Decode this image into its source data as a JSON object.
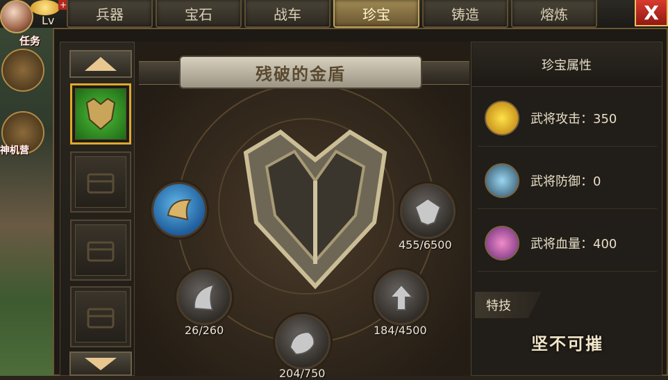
{
  "tabs": [
    {
      "label": "兵器"
    },
    {
      "label": "宝石"
    },
    {
      "label": "战车"
    },
    {
      "label": "珍宝",
      "active": true
    },
    {
      "label": "铸造"
    },
    {
      "label": "熔炼"
    }
  ],
  "close_label": "X",
  "player": {
    "level_prefix": "Lv"
  },
  "sidebar": {
    "task_label": "任务",
    "shop_label": "神机营"
  },
  "treasure": {
    "title": "残破的金盾",
    "parts": [
      {
        "icon": "blue-shield-piece-icon",
        "count": ""
      },
      {
        "icon": "silver-crest-icon",
        "count": "455/6500"
      },
      {
        "icon": "silver-wing-icon",
        "count": "26/260"
      },
      {
        "icon": "silver-arrow-icon",
        "count": "184/4500"
      },
      {
        "icon": "silver-beast-icon",
        "count": "204/750"
      }
    ]
  },
  "attributes": {
    "header": "珍宝属性",
    "stats": [
      {
        "label": "武将攻击：350",
        "icon": "attack-icon",
        "color": "#f2c21a"
      },
      {
        "label": "武将防御：0",
        "icon": "defense-icon",
        "color": "#6aa7c9"
      },
      {
        "label": "武将血量：400",
        "icon": "health-icon",
        "color": "#b060c0"
      }
    ],
    "skill_tab": "特技",
    "skill_name": "坚不可摧"
  },
  "colors": {
    "accent": "#e0a92a",
    "close": "#d93b2f"
  }
}
